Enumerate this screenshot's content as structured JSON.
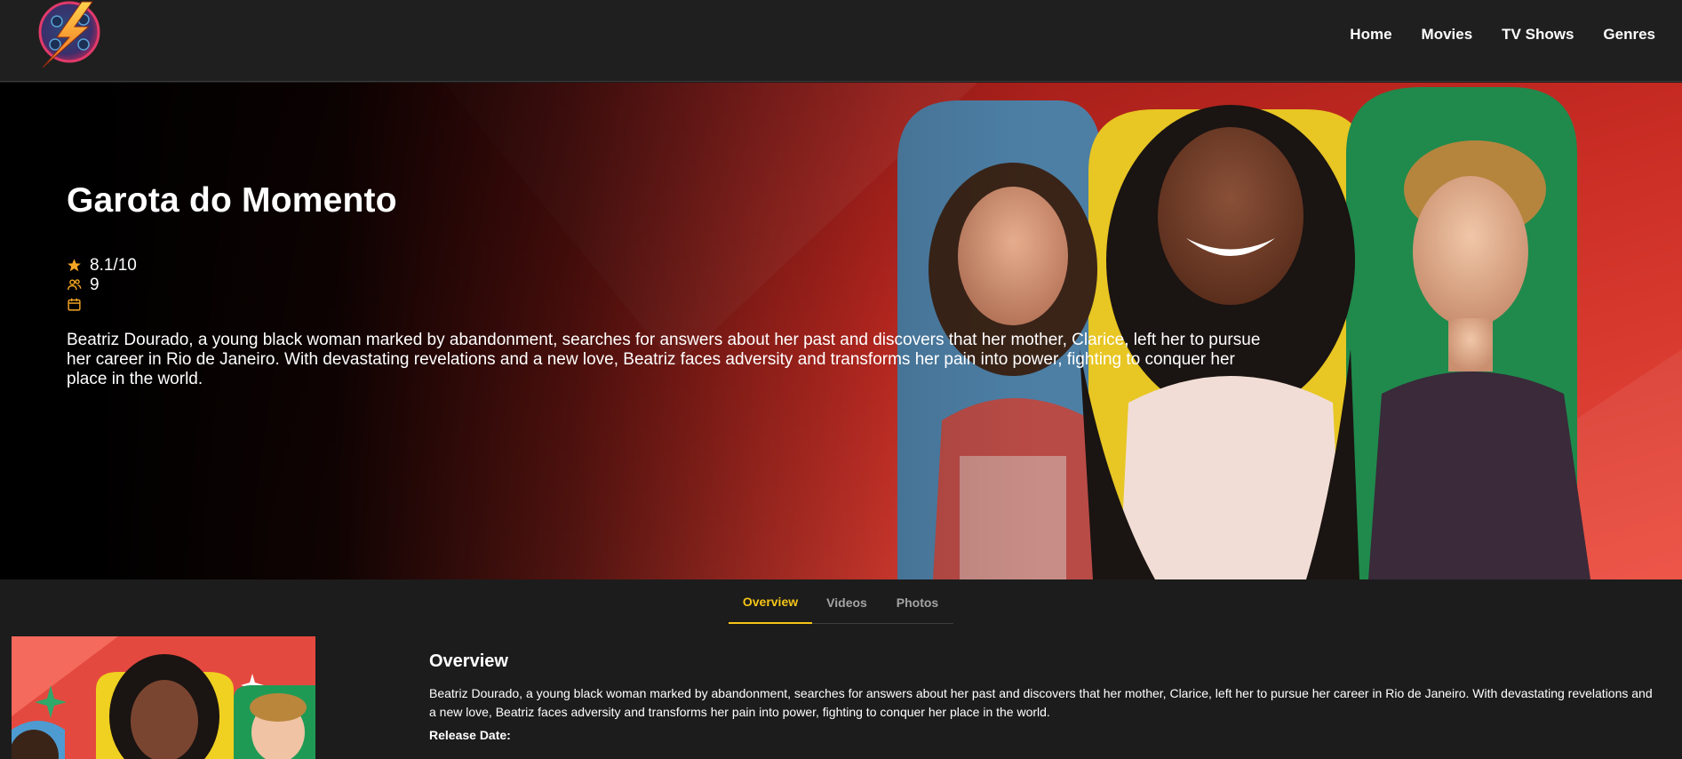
{
  "header": {
    "logo_icon": "lightning-film-reel-icon",
    "nav": [
      {
        "label": "Home"
      },
      {
        "label": "Movies"
      },
      {
        "label": "TV Shows"
      },
      {
        "label": "Genres"
      }
    ]
  },
  "hero": {
    "title": "Garota do Momento",
    "rating": "8.1/10",
    "vote_count": "9",
    "release_date": "",
    "overview": "Beatriz Dourado, a young black woman marked by abandonment, searches for answers about her past and discovers that her mother, Clarice, left her to pursue her career in Rio de Janeiro. With devastating revelations and a new love, Beatriz faces adversity and transforms her pain into power, fighting to conquer her place in the world.",
    "icons": {
      "rating": "star-icon",
      "votes": "users-icon",
      "date": "calendar-icon"
    },
    "accent_color": "#f5a623"
  },
  "tabs": [
    {
      "label": "Overview",
      "active": true
    },
    {
      "label": "Videos",
      "active": false
    },
    {
      "label": "Photos",
      "active": false
    }
  ],
  "details": {
    "heading": "Overview",
    "overview": "Beatriz Dourado, a young black woman marked by abandonment, searches for answers about her past and discovers that her mother, Clarice, left her to pursue her career in Rio de Janeiro. With devastating revelations and a new love, Beatriz faces adversity and transforms her pain into power, fighting to conquer her place in the world.",
    "release_date_label": "Release Date:"
  },
  "colors": {
    "background": "#1c1c1c",
    "header": "#1f1f1f",
    "active_tab": "#f5c518",
    "hero_red": "#c4231c"
  }
}
